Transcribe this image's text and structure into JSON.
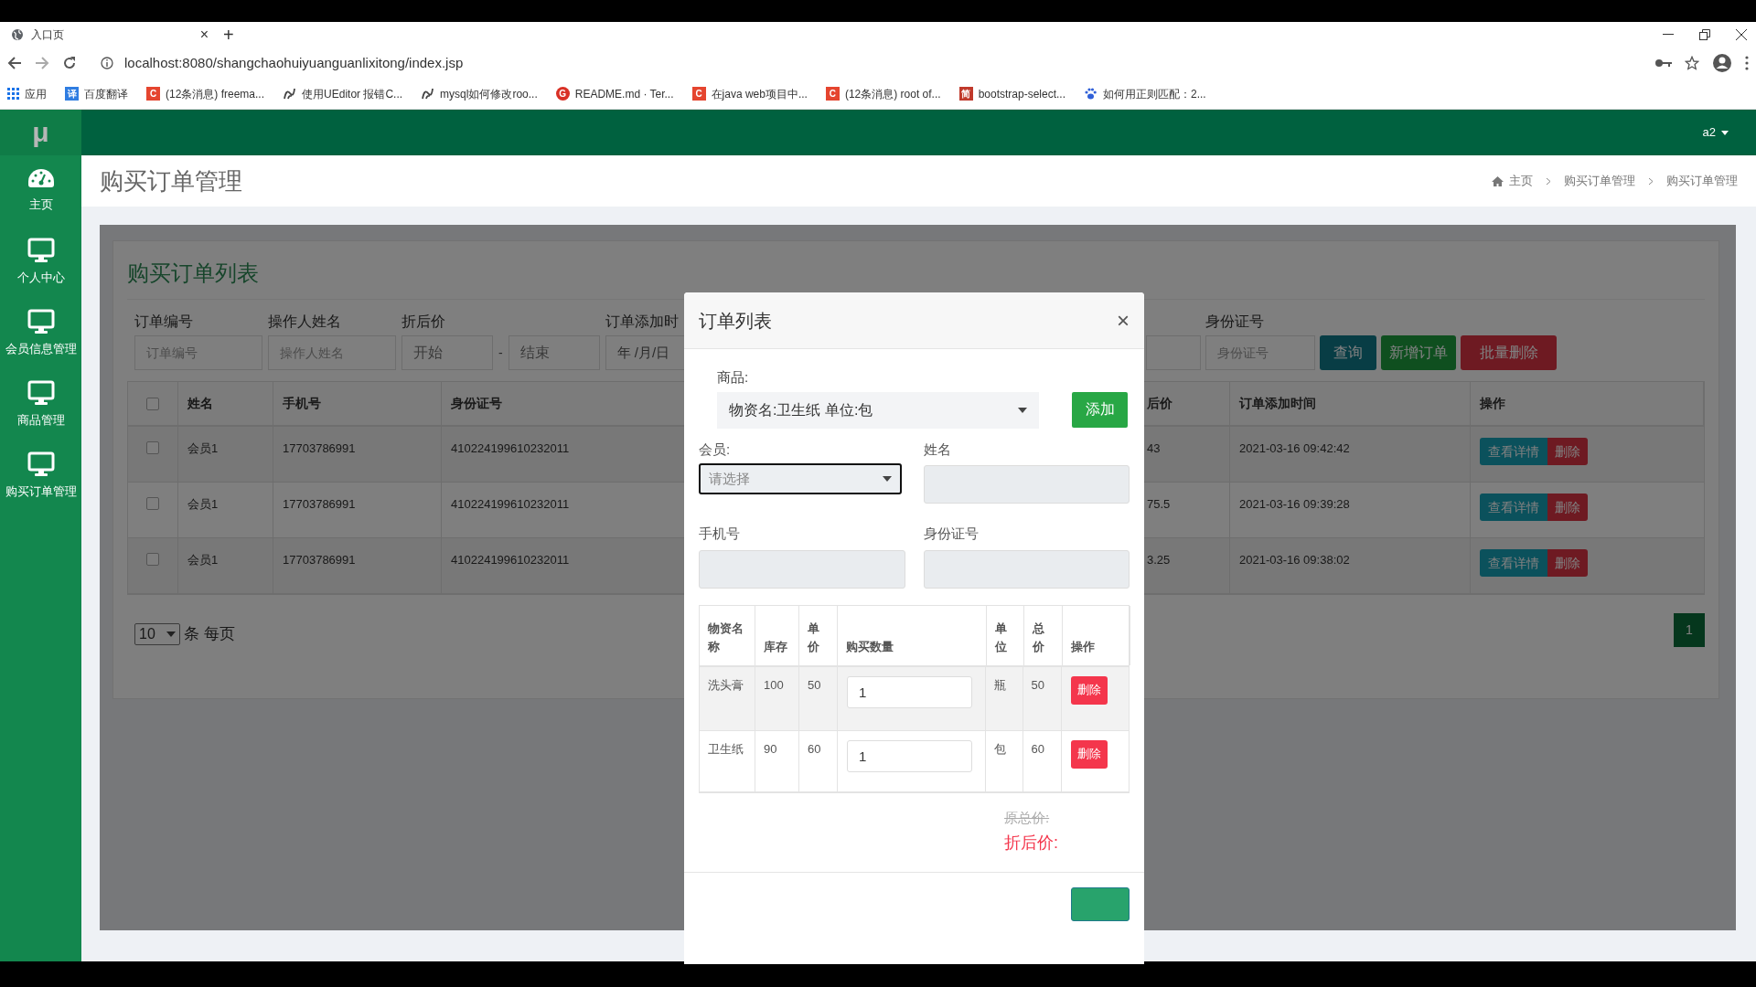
{
  "browser": {
    "tab": {
      "title": "入口页",
      "close": "×",
      "new_tab": "+"
    },
    "url": "localhost:8080/shangchaohuiyuanguanlixitong/index.jsp",
    "bookmarks": [
      {
        "label": "应用",
        "kind": "apps"
      },
      {
        "label": "百度翻译",
        "kind": "letter",
        "glyph": "译",
        "color": "#2f7de1"
      },
      {
        "label": "(12条消息) freema...",
        "kind": "letter",
        "glyph": "C",
        "color": "#e5452f"
      },
      {
        "label": "使用UEditor 报错C...",
        "kind": "swirl"
      },
      {
        "label": "mysql如何修改roo...",
        "kind": "swirl"
      },
      {
        "label": "README.md · Ter...",
        "kind": "circle",
        "glyph": "G",
        "color": "#d93025"
      },
      {
        "label": "在java web项目中...",
        "kind": "letter",
        "glyph": "C",
        "color": "#e5452f"
      },
      {
        "label": "(12条消息) root of...",
        "kind": "letter",
        "glyph": "C",
        "color": "#e5452f"
      },
      {
        "label": "bootstrap-select...",
        "kind": "letter",
        "glyph": "简",
        "color": "#c0392b"
      },
      {
        "label": "如何用正则匹配：2...",
        "kind": "paw"
      }
    ]
  },
  "sidebar": {
    "logo": "μ",
    "items": [
      {
        "label": "主页",
        "kind": "gauge"
      },
      {
        "label": "个人中心",
        "kind": "monitor"
      },
      {
        "label": "会员信息管理",
        "kind": "monitor"
      },
      {
        "label": "商品管理",
        "kind": "monitor"
      },
      {
        "label": "购买订单管理",
        "kind": "monitor"
      }
    ]
  },
  "header": {
    "user": "a2"
  },
  "page_title": "购买订单管理",
  "breadcrumb": [
    "主页",
    "购买订单管理",
    "购买订单管理"
  ],
  "card_title": "购买订单列表",
  "filters": {
    "fields": [
      {
        "label": "订单编号",
        "placeholder": "订单编号"
      },
      {
        "label": "操作人姓名",
        "placeholder": "操作人姓名"
      }
    ],
    "range": {
      "label": "折后价",
      "fields": [
        {
          "placeholder": "开始"
        },
        {
          "placeholder": "结束"
        }
      ],
      "separator": "-"
    },
    "date": {
      "label": "订单添加时",
      "value": "年 /月/日"
    },
    "id_field": {
      "label": "身份证号",
      "placeholder": "身份证号"
    },
    "buttons": [
      {
        "label": "查询",
        "kind": "info"
      },
      {
        "label": "新增订单",
        "kind": "success"
      },
      {
        "label": "批量删除",
        "kind": "danger"
      }
    ]
  },
  "table": {
    "select_all": {
      "checked": false
    },
    "columns": [
      "姓名",
      "手机号",
      "身份证号"
    ],
    "right_columns": [
      "后价",
      "订单添加时间",
      "操作"
    ],
    "rows": [
      {
        "checked": false,
        "name": "会员1",
        "phone": "17703786991",
        "id": "410224199610232011",
        "price": "43",
        "time": "2021-03-16 09:42:42",
        "actions": [
          "查看详情",
          "删除"
        ]
      },
      {
        "checked": false,
        "name": "会员1",
        "phone": "17703786991",
        "id": "410224199610232011",
        "price": "75.5",
        "time": "2021-03-16 09:39:28",
        "actions": [
          "查看详情",
          "删除"
        ]
      },
      {
        "checked": false,
        "name": "会员1",
        "phone": "17703786991",
        "id": "410224199610232011",
        "price": "3.25",
        "time": "2021-03-16 09:38:02",
        "actions": [
          "查看详情",
          "删除"
        ]
      }
    ]
  },
  "page_size": {
    "value": "10",
    "label": "条 每页"
  },
  "pagination": [
    {
      "label": "1",
      "selected": true
    }
  ],
  "modal": {
    "title": "订单列表",
    "close": "×",
    "product": {
      "label": "商品:",
      "value": "物资名:卫生纸 单位:包"
    },
    "add_button": "添加",
    "member": {
      "label": "会员:",
      "placeholder": "请选择"
    },
    "fields": [
      {
        "label": "姓名"
      },
      {
        "label": "手机号"
      },
      {
        "label": "身份证号"
      }
    ],
    "columns": [
      "物资名称",
      "库存",
      "单价",
      "购买数量",
      "单位",
      "总价",
      "操作"
    ],
    "rows": [
      {
        "name": "洗头膏",
        "stock": "100",
        "price": "50",
        "qty": "1",
        "unit": "瓶",
        "total": "50",
        "action": "删除"
      },
      {
        "name": "卫生纸",
        "stock": "90",
        "price": "60",
        "qty": "1",
        "unit": "包",
        "total": "60",
        "action": "删除"
      }
    ],
    "original_total": "原总价:",
    "discount_total": "折后价:"
  }
}
